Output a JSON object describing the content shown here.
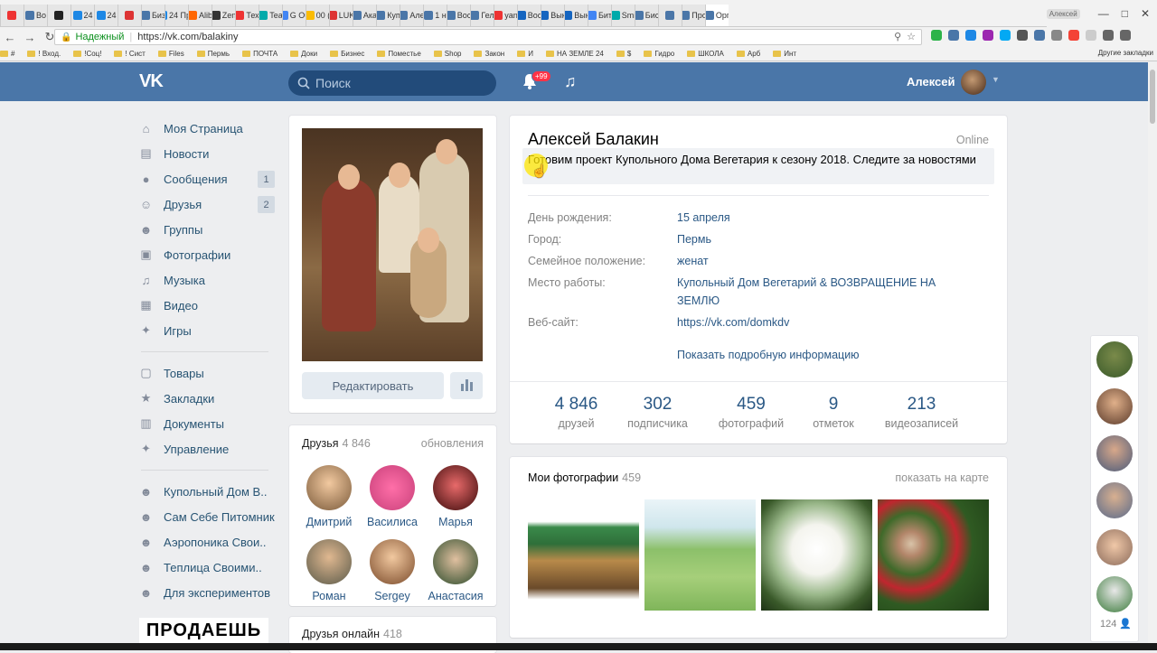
{
  "browser": {
    "tabs": [
      {
        "label": "",
        "color": "#e33"
      },
      {
        "label": "Bo",
        "color": "#4a76a8"
      },
      {
        "label": "",
        "color": "#222"
      },
      {
        "label": "24",
        "color": "#1e88e5"
      },
      {
        "label": "24",
        "color": "#1e88e5"
      },
      {
        "label": "",
        "color": "#d33"
      },
      {
        "label": "Биз",
        "color": "#4a76a8"
      },
      {
        "label": "24 Про",
        "color": "#1e88e5"
      },
      {
        "label": "Alib",
        "color": "#f60"
      },
      {
        "label": "Zen",
        "color": "#333"
      },
      {
        "label": "Тех",
        "color": "#e33"
      },
      {
        "label": "Tea",
        "color": "#0aa"
      },
      {
        "label": "G Ou",
        "color": "#4285f4"
      },
      {
        "label": "00 (",
        "color": "#fbbc05"
      },
      {
        "label": "LUK",
        "color": "#d33"
      },
      {
        "label": "Ака",
        "color": "#4a76a8"
      },
      {
        "label": "Куп",
        "color": "#4a76a8"
      },
      {
        "label": "Але",
        "color": "#4a76a8"
      },
      {
        "label": "1 н",
        "color": "#4a76a8"
      },
      {
        "label": "Вос",
        "color": "#4a76a8"
      },
      {
        "label": "Гел",
        "color": "#4a76a8"
      },
      {
        "label": "yan",
        "color": "#e33"
      },
      {
        "label": "Вос",
        "color": "#1565c0"
      },
      {
        "label": "Вык",
        "color": "#1565c0"
      },
      {
        "label": "Вык",
        "color": "#1565c0"
      },
      {
        "label": "Бит",
        "color": "#4285f4"
      },
      {
        "label": "Smi",
        "color": "#0aa"
      },
      {
        "label": "Бис",
        "color": "#4a76a8"
      },
      {
        "label": "",
        "color": "#4a76a8"
      },
      {
        "label": "Про",
        "color": "#4a76a8"
      },
      {
        "label": "Орг",
        "color": "#4a76a8"
      }
    ],
    "user_badge": "Алексей",
    "secure_label": "Надежный",
    "url": "https://vk.com/balakiny",
    "bookmarks": [
      {
        "label": "#"
      },
      {
        "label": "! Вход."
      },
      {
        "label": "!Соц!"
      },
      {
        "label": "! Сист"
      },
      {
        "label": "Files"
      },
      {
        "label": "Пермь"
      },
      {
        "label": "ПОЧТА"
      },
      {
        "label": "Доки"
      },
      {
        "label": "Бизнес"
      },
      {
        "label": "Поместье"
      },
      {
        "label": "Shop"
      },
      {
        "label": "Закон"
      },
      {
        "label": "И"
      },
      {
        "label": "НА ЗЕМЛЕ 24"
      },
      {
        "label": "$"
      },
      {
        "label": "Гидро"
      },
      {
        "label": "ШКОЛА"
      },
      {
        "label": "Арб"
      },
      {
        "label": "Инт"
      }
    ],
    "other_bookmarks": "Другие закладки"
  },
  "header": {
    "logo": "VK",
    "search_placeholder": "Поиск",
    "notif_badge": "+99",
    "user_name": "Алексей"
  },
  "leftnav": {
    "items": [
      {
        "label": "Моя Страница",
        "icon": "home-icon",
        "count": ""
      },
      {
        "label": "Новости",
        "icon": "news-icon",
        "count": ""
      },
      {
        "label": "Сообщения",
        "icon": "messages-icon",
        "count": "1"
      },
      {
        "label": "Друзья",
        "icon": "friends-icon",
        "count": "2"
      },
      {
        "label": "Группы",
        "icon": "groups-icon",
        "count": ""
      },
      {
        "label": "Фотографии",
        "icon": "camera-icon",
        "count": ""
      },
      {
        "label": "Музыка",
        "icon": "music-icon",
        "count": ""
      },
      {
        "label": "Видео",
        "icon": "video-icon",
        "count": ""
      },
      {
        "label": "Игры",
        "icon": "gamepad-icon",
        "count": ""
      }
    ],
    "items2": [
      {
        "label": "Товары",
        "icon": "bag-icon"
      },
      {
        "label": "Закладки",
        "icon": "star-icon"
      },
      {
        "label": "Документы",
        "icon": "document-icon"
      },
      {
        "label": "Управление",
        "icon": "gamepad-icon"
      }
    ],
    "groups": [
      {
        "label": "Купольный Дом В.."
      },
      {
        "label": "Сам Себе Питомник"
      },
      {
        "label": "Аэропоника Свои.."
      },
      {
        "label": "Теплица Своими.."
      },
      {
        "label": "Для экспериментов"
      }
    ],
    "promo": "ПРОДАЕШЬ"
  },
  "profile": {
    "edit_label": "Редактировать",
    "name": "Алексей Балакин",
    "online": "Online",
    "status": "Готовим проект Купольного Дома Вегетария к сезону 2018. Следите за новостями",
    "info": [
      {
        "label": "День рождения:",
        "value": "15 апреля"
      },
      {
        "label": "Город:",
        "value": "Пермь"
      },
      {
        "label": "Семейное положение:",
        "value": "женат"
      },
      {
        "label": "Место работы:",
        "value": "Купольный Дом Вегетарий & ВОЗВРАЩЕНИЕ НА ЗЕМЛЮ"
      },
      {
        "label": "Веб-сайт:",
        "value": "https://vk.com/domkdv"
      }
    ],
    "show_more": "Показать подробную информацию",
    "counters": [
      {
        "num": "4 846",
        "label": "друзей"
      },
      {
        "num": "302",
        "label": "подписчика"
      },
      {
        "num": "459",
        "label": "фотографий"
      },
      {
        "num": "9",
        "label": "отметок"
      },
      {
        "num": "213",
        "label": "видеозаписей"
      }
    ]
  },
  "friends": {
    "title": "Друзья",
    "count": "4 846",
    "updates": "обновления",
    "list": [
      {
        "name": "Дмитрий"
      },
      {
        "name": "Василиса"
      },
      {
        "name": "Марья"
      },
      {
        "name": "Роман"
      },
      {
        "name": "Sergey"
      },
      {
        "name": "Анастасия"
      }
    ],
    "online_title": "Друзья онлайн",
    "online_count": "418"
  },
  "photos": {
    "title": "Мои фотографии",
    "count": "459",
    "map_link": "показать на карте"
  },
  "rail": {
    "count": "124"
  },
  "colors": {
    "header": "#4a76a8",
    "link": "#2a5885",
    "badge": "#ff3347"
  }
}
